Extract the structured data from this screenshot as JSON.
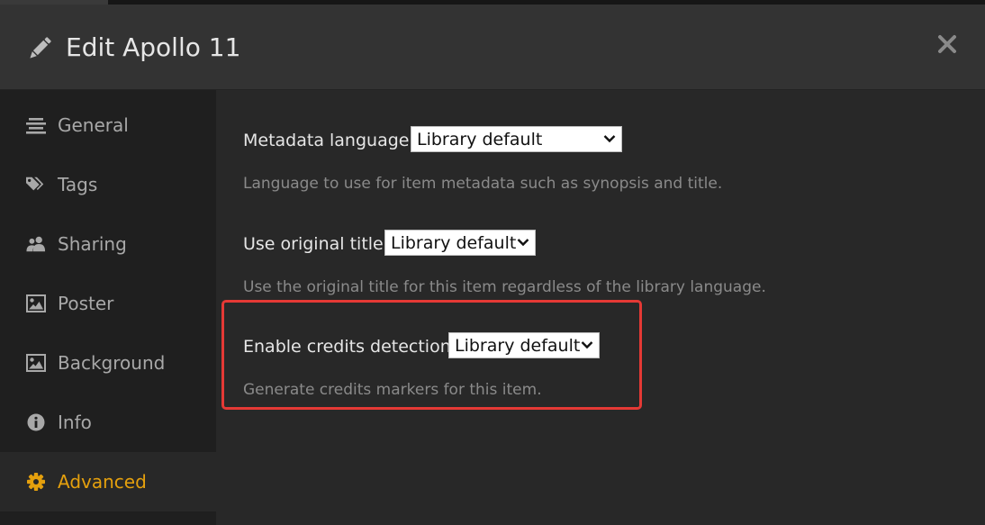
{
  "header": {
    "title": "Edit Apollo 11",
    "edit_icon": "pencil-icon",
    "close_icon": "close-icon"
  },
  "sidebar": {
    "items": [
      {
        "label": "General",
        "icon": "align-lines-icon",
        "active": false
      },
      {
        "label": "Tags",
        "icon": "tags-icon",
        "active": false
      },
      {
        "label": "Sharing",
        "icon": "users-icon",
        "active": false
      },
      {
        "label": "Poster",
        "icon": "image-icon",
        "active": false
      },
      {
        "label": "Background",
        "icon": "image-icon",
        "active": false
      },
      {
        "label": "Info",
        "icon": "info-circle-icon",
        "active": false
      },
      {
        "label": "Advanced",
        "icon": "gear-icon",
        "active": true
      }
    ]
  },
  "settings": {
    "metadata_language": {
      "label": "Metadata language",
      "value": "Library default",
      "help": "Language to use for item metadata such as synopsis and title."
    },
    "original_title": {
      "label": "Use original title",
      "value": "Library default",
      "help": "Use the original title for this item regardless of the library language."
    },
    "credits_detection": {
      "label": "Enable credits detection",
      "value": "Library default",
      "help": "Generate credits markers for this item."
    }
  },
  "colors": {
    "accent": "#e5a00d",
    "highlight_border": "#e53935",
    "header_bg": "#333333",
    "sidebar_bg": "#1f1f1f",
    "content_bg": "#282828"
  }
}
